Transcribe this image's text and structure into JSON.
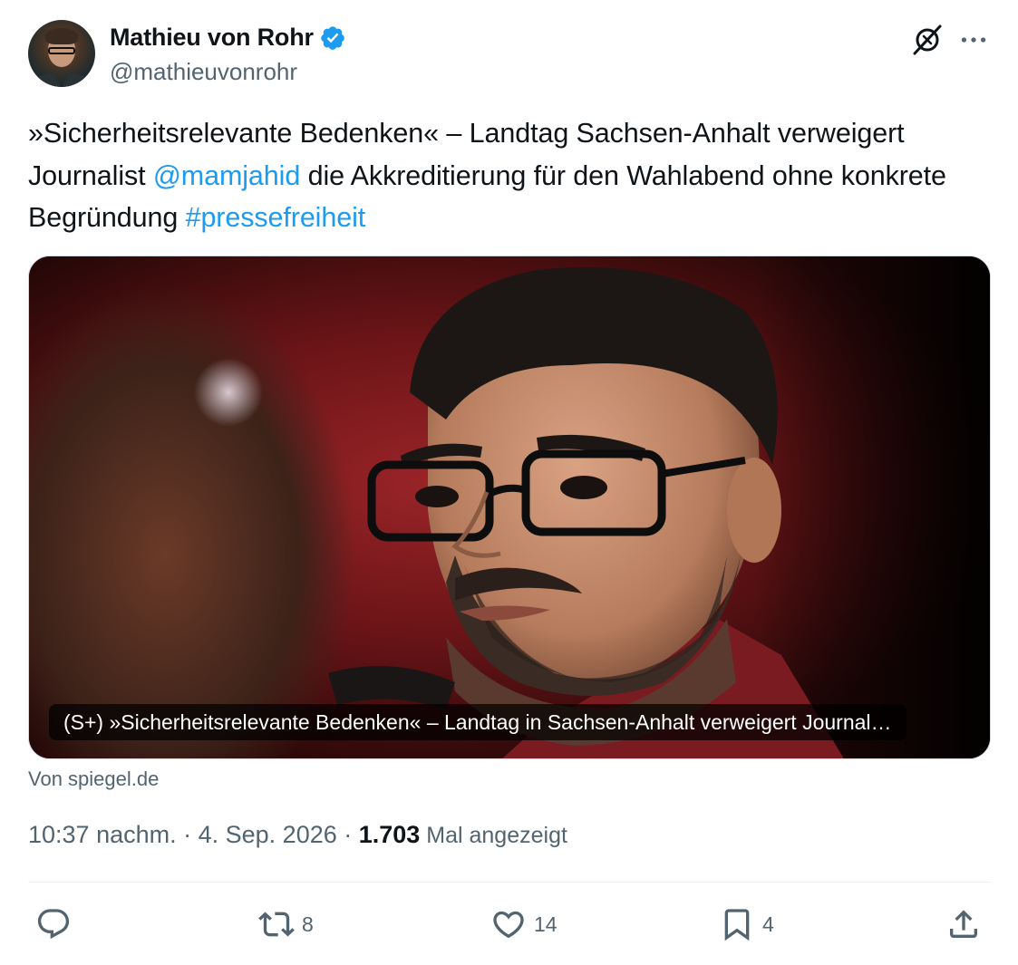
{
  "author": {
    "display_name": "Mathieu von Rohr",
    "handle": "@mathieuvonrohr",
    "verified": true,
    "verified_color": "#1d9bf0"
  },
  "header_icons": [
    "grok-icon",
    "more-icon"
  ],
  "tweet": {
    "text_part1": "»Sicherheitsrelevante Bedenken« – Landtag Sachsen-Anhalt verweigert Journalist ",
    "mention": "@mamjahid",
    "text_part2": " die Akkreditierung für den Wahlabend ohne konkrete Begründung  ",
    "hashtag": "#pressefreiheit",
    "link_color": "#1d9bf0"
  },
  "card": {
    "caption": "(S+) »Sicherheitsrelevante Bedenken« – Landtag in Sachsen-Anhalt verweigert Journal…",
    "source": "Von spiegel.de"
  },
  "meta": {
    "time": "10:37 nachm.",
    "separator": " · ",
    "date": "4. Sep. 2026",
    "views_count": "1.703",
    "views_label": " Mal angezeigt"
  },
  "actions": {
    "reply": {
      "icon": "reply-icon",
      "count": ""
    },
    "retweet": {
      "icon": "retweet-icon",
      "count": "8"
    },
    "like": {
      "icon": "heart-icon",
      "count": "14"
    },
    "bookmark": {
      "icon": "bookmark-icon",
      "count": "4"
    },
    "share": {
      "icon": "share-icon",
      "count": ""
    }
  },
  "colors": {
    "text_primary": "#0f1419",
    "text_secondary": "#536471",
    "accent": "#1d9bf0",
    "divider": "#eff3f4"
  }
}
